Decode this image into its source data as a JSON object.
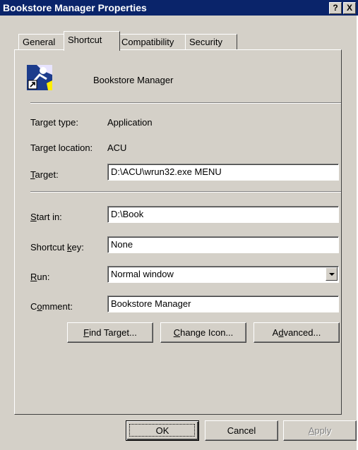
{
  "window": {
    "title": "Bookstore Manager Properties",
    "help_button": "?",
    "close_button": "X"
  },
  "tabs": [
    {
      "label": "General"
    },
    {
      "label": "Shortcut",
      "active": true
    },
    {
      "label": "Compatibility"
    },
    {
      "label": "Security"
    }
  ],
  "shortcut": {
    "icon": "app-shortcut-icon",
    "name": "Bookstore Manager",
    "target_type_label": "Target type:",
    "target_type_value": "Application",
    "target_location_label": "Target location:",
    "target_location_value": "ACU",
    "target_label_access": "T",
    "target_label_rest": "arget:",
    "target_value": "D:\\ACU\\wrun32.exe MENU",
    "start_in_label_access": "S",
    "start_in_label_rest": "tart in:",
    "start_in_value": "D:\\Book",
    "shortcut_key_label_pre": "Shortcut ",
    "shortcut_key_label_access": "k",
    "shortcut_key_label_rest": "ey:",
    "shortcut_key_value": "None",
    "run_label_access": "R",
    "run_label_rest": "un:",
    "run_value": "Normal window",
    "comment_label_pre": "C",
    "comment_label_access": "o",
    "comment_label_rest": "mment:",
    "comment_value": "Bookstore Manager",
    "find_target_access": "F",
    "find_target_rest": "ind Target...",
    "change_icon_access": "C",
    "change_icon_rest": "hange Icon...",
    "advanced_pre": "A",
    "advanced_access": "d",
    "advanced_rest": "vanced..."
  },
  "footer": {
    "ok_label": "OK",
    "cancel_label": "Cancel",
    "apply_access": "A",
    "apply_rest": "pply"
  },
  "colors": {
    "titlebar": "#0a246a",
    "face": "#d4d0c8"
  }
}
